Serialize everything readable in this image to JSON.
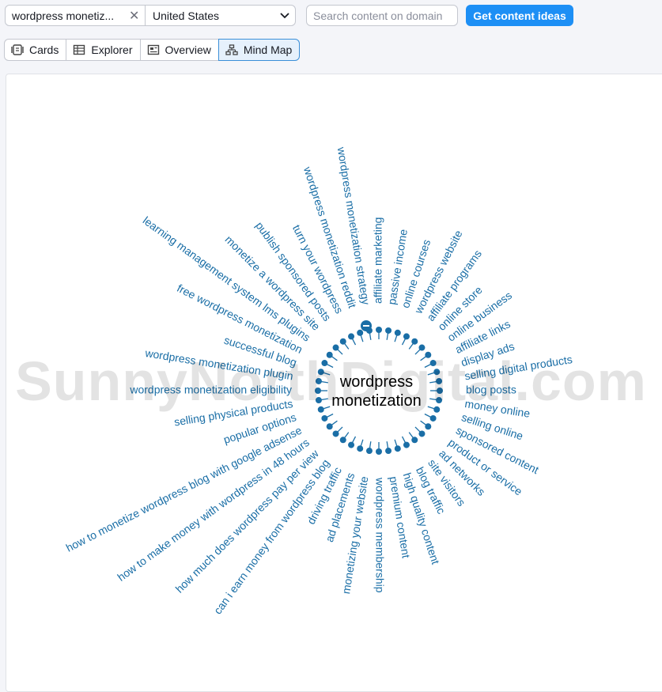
{
  "search_bar": {
    "keyword": "wordpress monetiz...",
    "country": "United States",
    "domain_placeholder": "Search content on domain",
    "cta_label": "Get content ideas"
  },
  "tabs": [
    {
      "label": "Cards",
      "icon": "cards-icon"
    },
    {
      "label": "Explorer",
      "icon": "table-icon"
    },
    {
      "label": "Overview",
      "icon": "overview-icon"
    },
    {
      "label": "Mind Map",
      "icon": "mindmap-icon",
      "active": true
    }
  ],
  "mind_map": {
    "center": [
      "wordpress",
      "monetization"
    ],
    "topics": [
      "affiliate marketing",
      "passive income",
      "online courses",
      "wordpress website",
      "affiliate programs",
      "online store",
      "online business",
      "affiliate links",
      "display ads",
      "selling digital products",
      "blog posts",
      "money online",
      "selling online",
      "sponsored content",
      "product or service",
      "ad networks",
      "site visitors",
      "blog traffic",
      "high quality content",
      "premium content",
      "wordpress membership",
      "monetizing your website",
      "ad placements",
      "driving traffic",
      "can i earn money from wordpress blog",
      "how much does wordpress pay per view",
      "how to make money with wordpress in 48 hours",
      "how to monetize wordpress blog with google adsense",
      "popular options",
      "selling physical products",
      "wordpress monetization eligibility",
      "wordpress monetization plugin",
      "successful blog",
      "free wordpress monetization",
      "learning management system lms plugins",
      "monetize a wordpress site",
      "publish sponsored posts",
      "turn your wordpress",
      "wordpress monetization reddit",
      "wordpress monetization strategy"
    ],
    "link_color": "#1a6ea6",
    "node_color": "#1a6ea6"
  },
  "watermark": "SunnyNorthDigital.com"
}
